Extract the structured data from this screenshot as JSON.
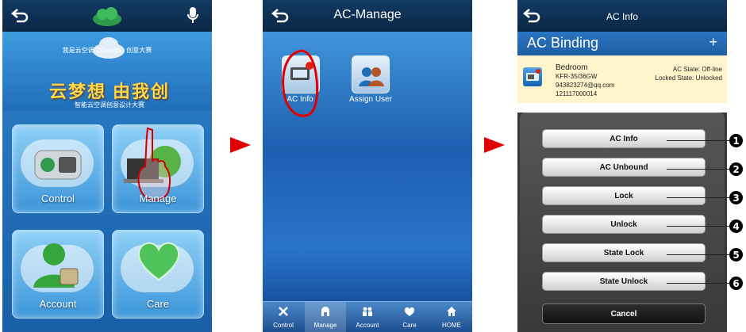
{
  "phone1": {
    "banner_small": "我是云空调 DiDongo - 创意大赛",
    "banner_title": "云梦想 由我创",
    "banner_sub": "智能云空调创意设计大赛",
    "tiles": [
      {
        "label": "Control"
      },
      {
        "label": "Manage"
      },
      {
        "label": "Account"
      },
      {
        "label": "Care"
      }
    ]
  },
  "phone2": {
    "title": "AC-Manage",
    "apps": [
      {
        "label": "AC Info"
      },
      {
        "label": "Assign User"
      }
    ],
    "bottom_nav": [
      {
        "label": "Control"
      },
      {
        "label": "Manage"
      },
      {
        "label": "Account"
      },
      {
        "label": "Care"
      },
      {
        "label": "HOME"
      }
    ]
  },
  "phone3": {
    "title": "AC Info",
    "section_title": "AC Binding",
    "add_label": "+",
    "binding": {
      "name": "Bedroom",
      "model": "KFR-35/36GW",
      "email": "943823274@qq.com",
      "id": "121117000014",
      "ac_state": "AC State: Off-line",
      "locked_state": "Locked State: Unlocked"
    },
    "menu": [
      {
        "label": "AC Info",
        "num": "1"
      },
      {
        "label": "AC Unbound",
        "num": "2"
      },
      {
        "label": "Lock",
        "num": "3"
      },
      {
        "label": "Unlock",
        "num": "4"
      },
      {
        "label": "State Lock",
        "num": "5"
      },
      {
        "label": "State Unlock",
        "num": "6"
      }
    ],
    "cancel_label": "Cancel"
  },
  "colors": {
    "arrow": "#e00000",
    "topbar": "#0b2746",
    "highlight_row": "#fff4cc"
  }
}
